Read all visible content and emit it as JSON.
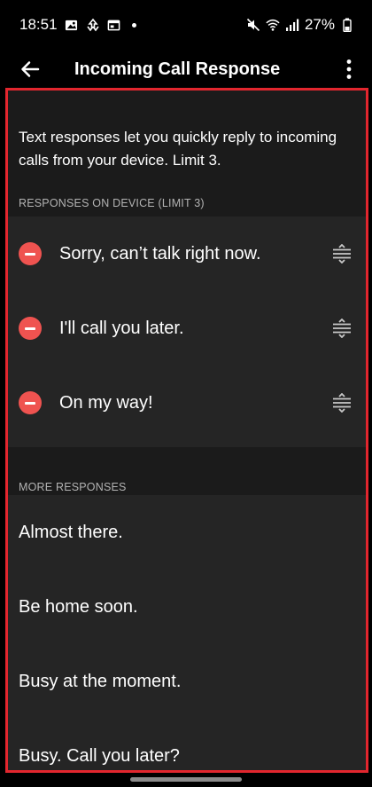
{
  "status_bar": {
    "time": "18:51",
    "battery": "27%",
    "icons_left": [
      "image-icon",
      "sync-icon",
      "calendar-icon"
    ],
    "icons_right": [
      "mute-icon",
      "wifi-icon",
      "signal-icon",
      "battery-icon"
    ]
  },
  "app_bar": {
    "title": "Incoming Call Response"
  },
  "intro_text": "Text responses let you quickly reply to incoming calls from your device. Limit 3.",
  "device_section": {
    "header": "RESPONSES ON DEVICE (LIMIT 3)",
    "items": [
      {
        "text": "Sorry, can’t talk right now."
      },
      {
        "text": "I'll call you later."
      },
      {
        "text": "On my way!"
      }
    ]
  },
  "more_section": {
    "header": "MORE RESPONSES",
    "items": [
      {
        "text": "Almost there."
      },
      {
        "text": "Be home soon."
      },
      {
        "text": "Busy at the moment."
      },
      {
        "text": "Busy. Call you later?"
      }
    ]
  },
  "colors": {
    "accent_red": "#e2262e",
    "remove_red": "#ef5350",
    "row_bg": "#252525",
    "page_bg": "#1b1b1b"
  }
}
